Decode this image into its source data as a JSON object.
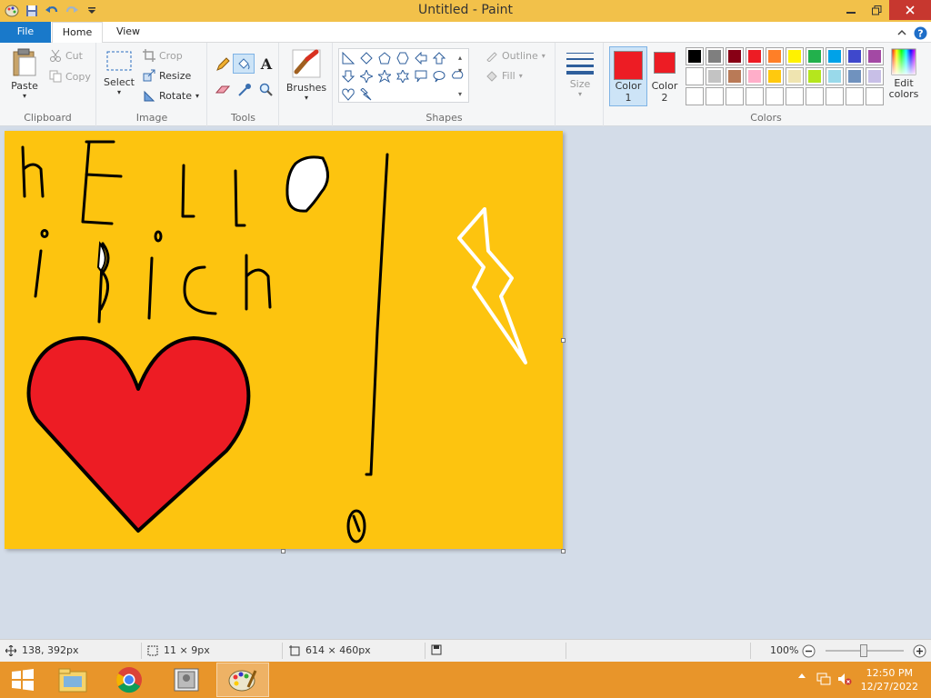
{
  "window": {
    "title": "Untitled - Paint"
  },
  "tabs": {
    "file": "File",
    "home": "Home",
    "view": "View"
  },
  "clipboard": {
    "paste": "Paste",
    "cut": "Cut",
    "copy": "Copy",
    "label": "Clipboard"
  },
  "image": {
    "select": "Select",
    "crop": "Crop",
    "resize": "Resize",
    "rotate": "Rotate",
    "label": "Image"
  },
  "tools": {
    "label": "Tools"
  },
  "brushes": {
    "label": "Brushes"
  },
  "shapes": {
    "outline": "Outline",
    "fill": "Fill",
    "label": "Shapes"
  },
  "size": {
    "label": "Size"
  },
  "colors": {
    "color1": "Color",
    "color1_num": "1",
    "color2": "Color",
    "color2_num": "2",
    "edit_colors": "Edit colors",
    "label": "Colors",
    "color1_value": "#ed1c24",
    "color2_value": "#ed1c24",
    "palette_row1": [
      "#000000",
      "#7f7f7f",
      "#880015",
      "#ed1c24",
      "#ff7f27",
      "#fff200",
      "#22b14c",
      "#00a2e8",
      "#3f48cc",
      "#a349a4"
    ],
    "palette_row2": [
      "#ffffff",
      "#c3c3c3",
      "#b97a57",
      "#ffaec9",
      "#ffc90e",
      "#efe4b0",
      "#b5e61d",
      "#99d9ea",
      "#7092be",
      "#c8bfe7"
    ]
  },
  "canvas": {
    "background": "#fdc40f"
  },
  "status": {
    "cursor_pos": "138, 392px",
    "selection_size": "11 × 9px",
    "image_size": "614 × 460px",
    "zoom": "100%"
  },
  "taskbar": {
    "time": "12:50 PM",
    "date": "12/27/2022"
  }
}
